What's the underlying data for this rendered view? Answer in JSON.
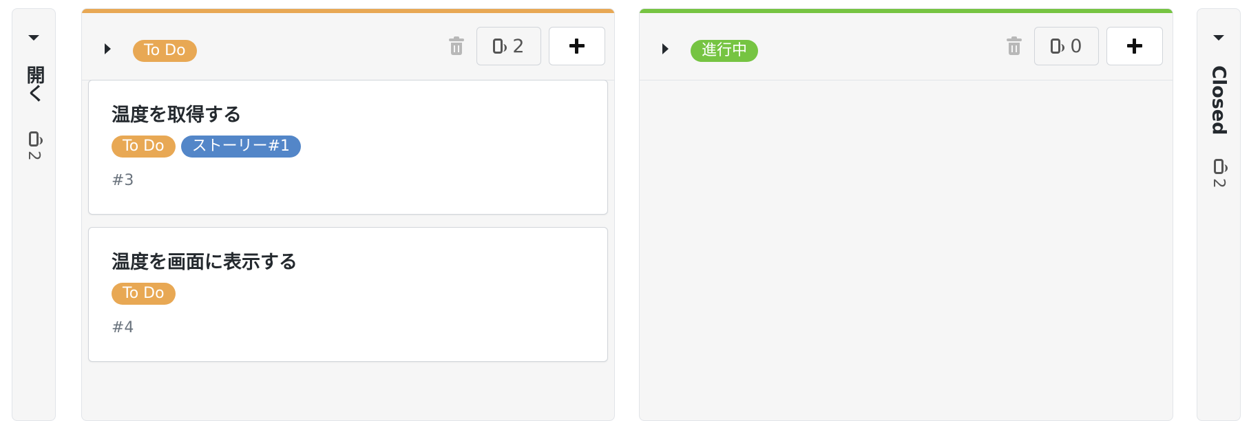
{
  "colors": {
    "todo": "#e8a854",
    "in_progress": "#76c442",
    "story": "#5386c8"
  },
  "left_collapsed": {
    "title": "開く",
    "count": "2"
  },
  "right_collapsed": {
    "title": "Closed",
    "count": "2"
  },
  "columns": [
    {
      "label": "To Do",
      "count": "2",
      "cards": [
        {
          "title": "温度を取得する",
          "labels": [
            "To Do",
            "ストーリー#1"
          ],
          "number": "#3"
        },
        {
          "title": "温度を画面に表示する",
          "labels": [
            "To Do"
          ],
          "number": "#4"
        }
      ]
    },
    {
      "label": "進行中",
      "count": "0",
      "cards": []
    }
  ]
}
